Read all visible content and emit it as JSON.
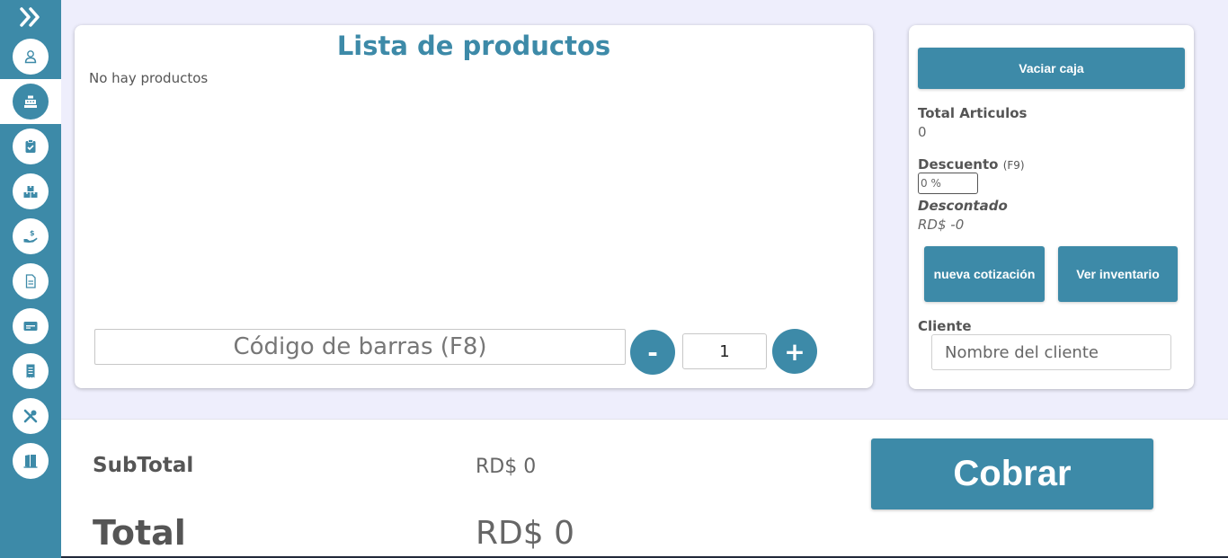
{
  "sidebar": {
    "expand_icon": "double-chevron-right-icon",
    "items": [
      {
        "icon": "user-icon",
        "active": false
      },
      {
        "icon": "cash-register-icon",
        "active": true
      },
      {
        "icon": "clipboard-check-icon",
        "active": false
      },
      {
        "icon": "boxes-icon",
        "active": false
      },
      {
        "icon": "hand-money-icon",
        "active": false
      },
      {
        "icon": "document-icon",
        "active": false
      },
      {
        "icon": "card-icon",
        "active": false
      },
      {
        "icon": "receipt-icon",
        "active": false
      },
      {
        "icon": "tools-icon",
        "active": false
      },
      {
        "icon": "door-exit-icon",
        "active": false
      }
    ]
  },
  "products": {
    "title": "Lista de productos",
    "empty_text": "No hay productos",
    "barcode_placeholder": "Código de barras (F8)",
    "minus_label": "-",
    "plus_label": "+",
    "quantity": "1"
  },
  "side": {
    "vaciar_label": "Vaciar caja",
    "total_articulos_label": "Total Articulos",
    "total_articulos_value": "0",
    "descuento_label": "Descuento",
    "descuento_hint": "(F9)",
    "descuento_value": "0 %",
    "descontado_label": "Descontado",
    "descontado_value": "RD$ -0",
    "nueva_label": "nueva cotización",
    "inventario_label": "Ver inventario",
    "cliente_label": "Cliente",
    "cliente_placeholder": "Nombre del cliente"
  },
  "totals": {
    "subtotal_label": "SubTotal",
    "subtotal_value": "RD$ 0",
    "total_label": "Total",
    "total_value": "RD$ 0",
    "cobrar_label": "Cobrar"
  },
  "colors": {
    "accent": "#3d8aa8",
    "background": "#eeeefc"
  }
}
